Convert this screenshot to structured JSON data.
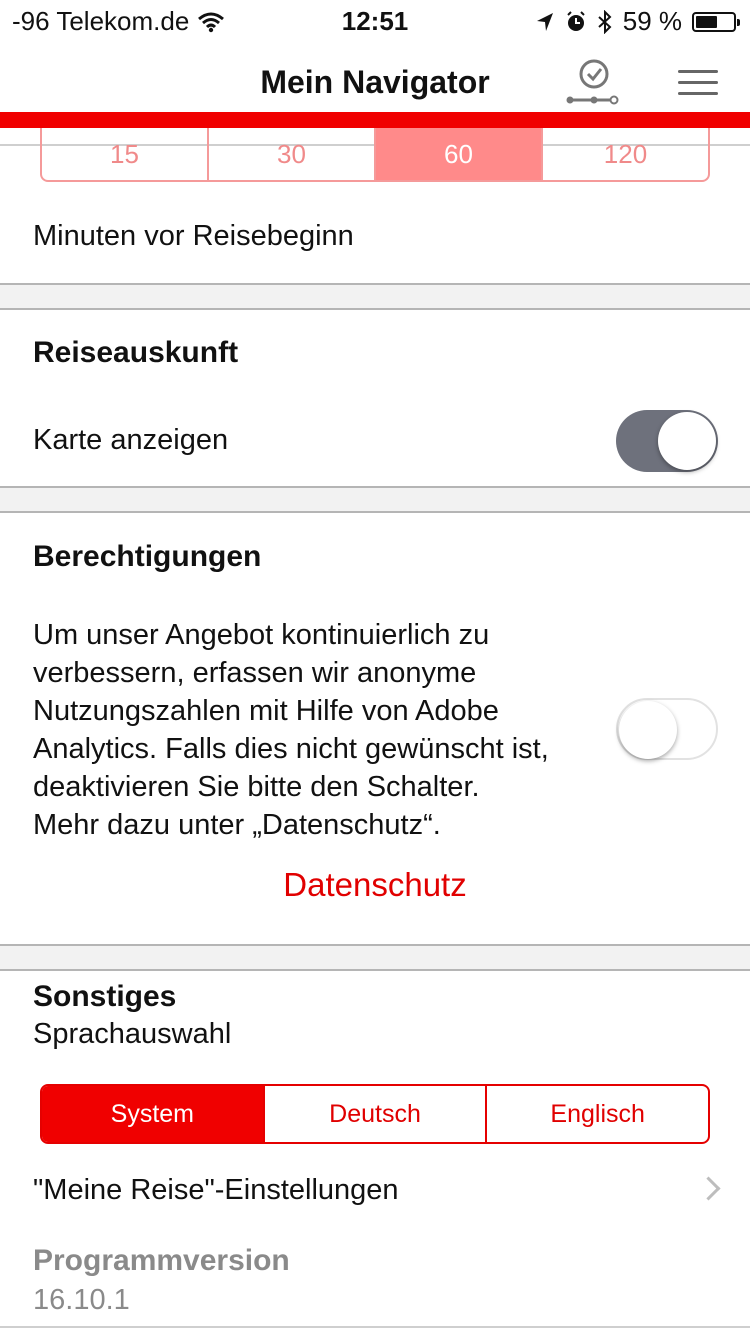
{
  "status_bar": {
    "carrier": "-96 Telekom.de",
    "time": "12:51",
    "battery": "59 %",
    "battery_level": 0.59,
    "icons": [
      "wifi-icon",
      "location-arrow-icon",
      "alarm-clock-icon",
      "bluetooth-icon",
      "battery-icon"
    ]
  },
  "header": {
    "title": "Mein Navigator",
    "journey_icon": "journey-check-icon",
    "menu_icon": "hamburger-menu-icon",
    "accent_color": "#f00000"
  },
  "reminder": {
    "options": [
      "15",
      "30",
      "60",
      "120"
    ],
    "selected": "60",
    "label": "Minuten vor Reisebeginn"
  },
  "travel_info": {
    "heading": "Reiseauskunft",
    "show_map_label": "Karte anzeigen",
    "show_map_enabled": true
  },
  "permissions": {
    "heading": "Berechtigungen",
    "text_lines": [
      "Um unser Angebot kontinuierlich zu",
      "verbessern, erfassen wir anonyme",
      "Nutzungszahlen mit Hilfe von Adobe",
      "Analytics. Falls dies nicht gewünscht ist,",
      "deaktivieren Sie bitte den Schalter.",
      "Mehr dazu unter „Datenschutz“."
    ],
    "analytics_enabled": false,
    "privacy_link": "Datenschutz"
  },
  "misc": {
    "heading": "Sonstiges",
    "language_label": "Sprachauswahl",
    "language_options": [
      "System",
      "Deutsch",
      "Englisch"
    ],
    "language_selected": "System",
    "my_trip_settings": "\"Meine Reise\"-Einstellungen",
    "version_label": "Programmversion",
    "version_value": "16.10.1"
  }
}
